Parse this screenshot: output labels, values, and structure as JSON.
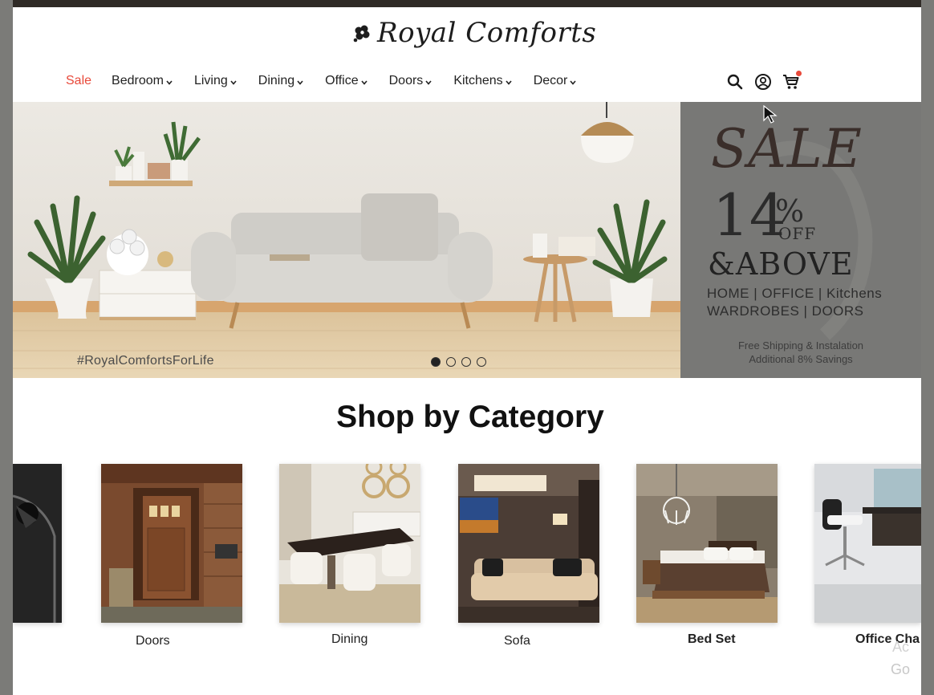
{
  "brand": {
    "name": "Royal Comforts"
  },
  "nav": {
    "items": [
      {
        "label": "Sale",
        "dropdown": false
      },
      {
        "label": "Bedroom",
        "dropdown": true
      },
      {
        "label": "Living",
        "dropdown": true
      },
      {
        "label": "Dining",
        "dropdown": true
      },
      {
        "label": "Office",
        "dropdown": true
      },
      {
        "label": "Doors",
        "dropdown": true
      },
      {
        "label": "Kitchens",
        "dropdown": true
      },
      {
        "label": "Decor",
        "dropdown": true
      }
    ],
    "icons": [
      "search-icon",
      "account-icon",
      "cart-icon"
    ]
  },
  "hero": {
    "hashtag": "#RoyalComfortsForLife",
    "slides_total": 4,
    "active_slide": 1,
    "promo": {
      "title": "SALE",
      "percent": "14",
      "percent_sign": "%",
      "off": "OFF",
      "above": "&ABOVE",
      "categories_line1": "HOME | OFFICE | Kitchens",
      "categories_line2": "WARDROBES | DOORS",
      "shipping": "Free Shipping & Instalation",
      "savings": "Additional 8% Savings"
    }
  },
  "categories": {
    "heading": "Shop by Category",
    "items": [
      {
        "label": ""
      },
      {
        "label": "Doors"
      },
      {
        "label": "Dining"
      },
      {
        "label": "Sofa"
      },
      {
        "label": "Bed Set"
      },
      {
        "label": "Office Cha"
      }
    ]
  },
  "watermark": {
    "line1": "Ac",
    "line2": "Go"
  },
  "colors": {
    "sale_red": "#e8493a",
    "top_bar": "#2f2a26",
    "promo_bg": "#787876"
  }
}
